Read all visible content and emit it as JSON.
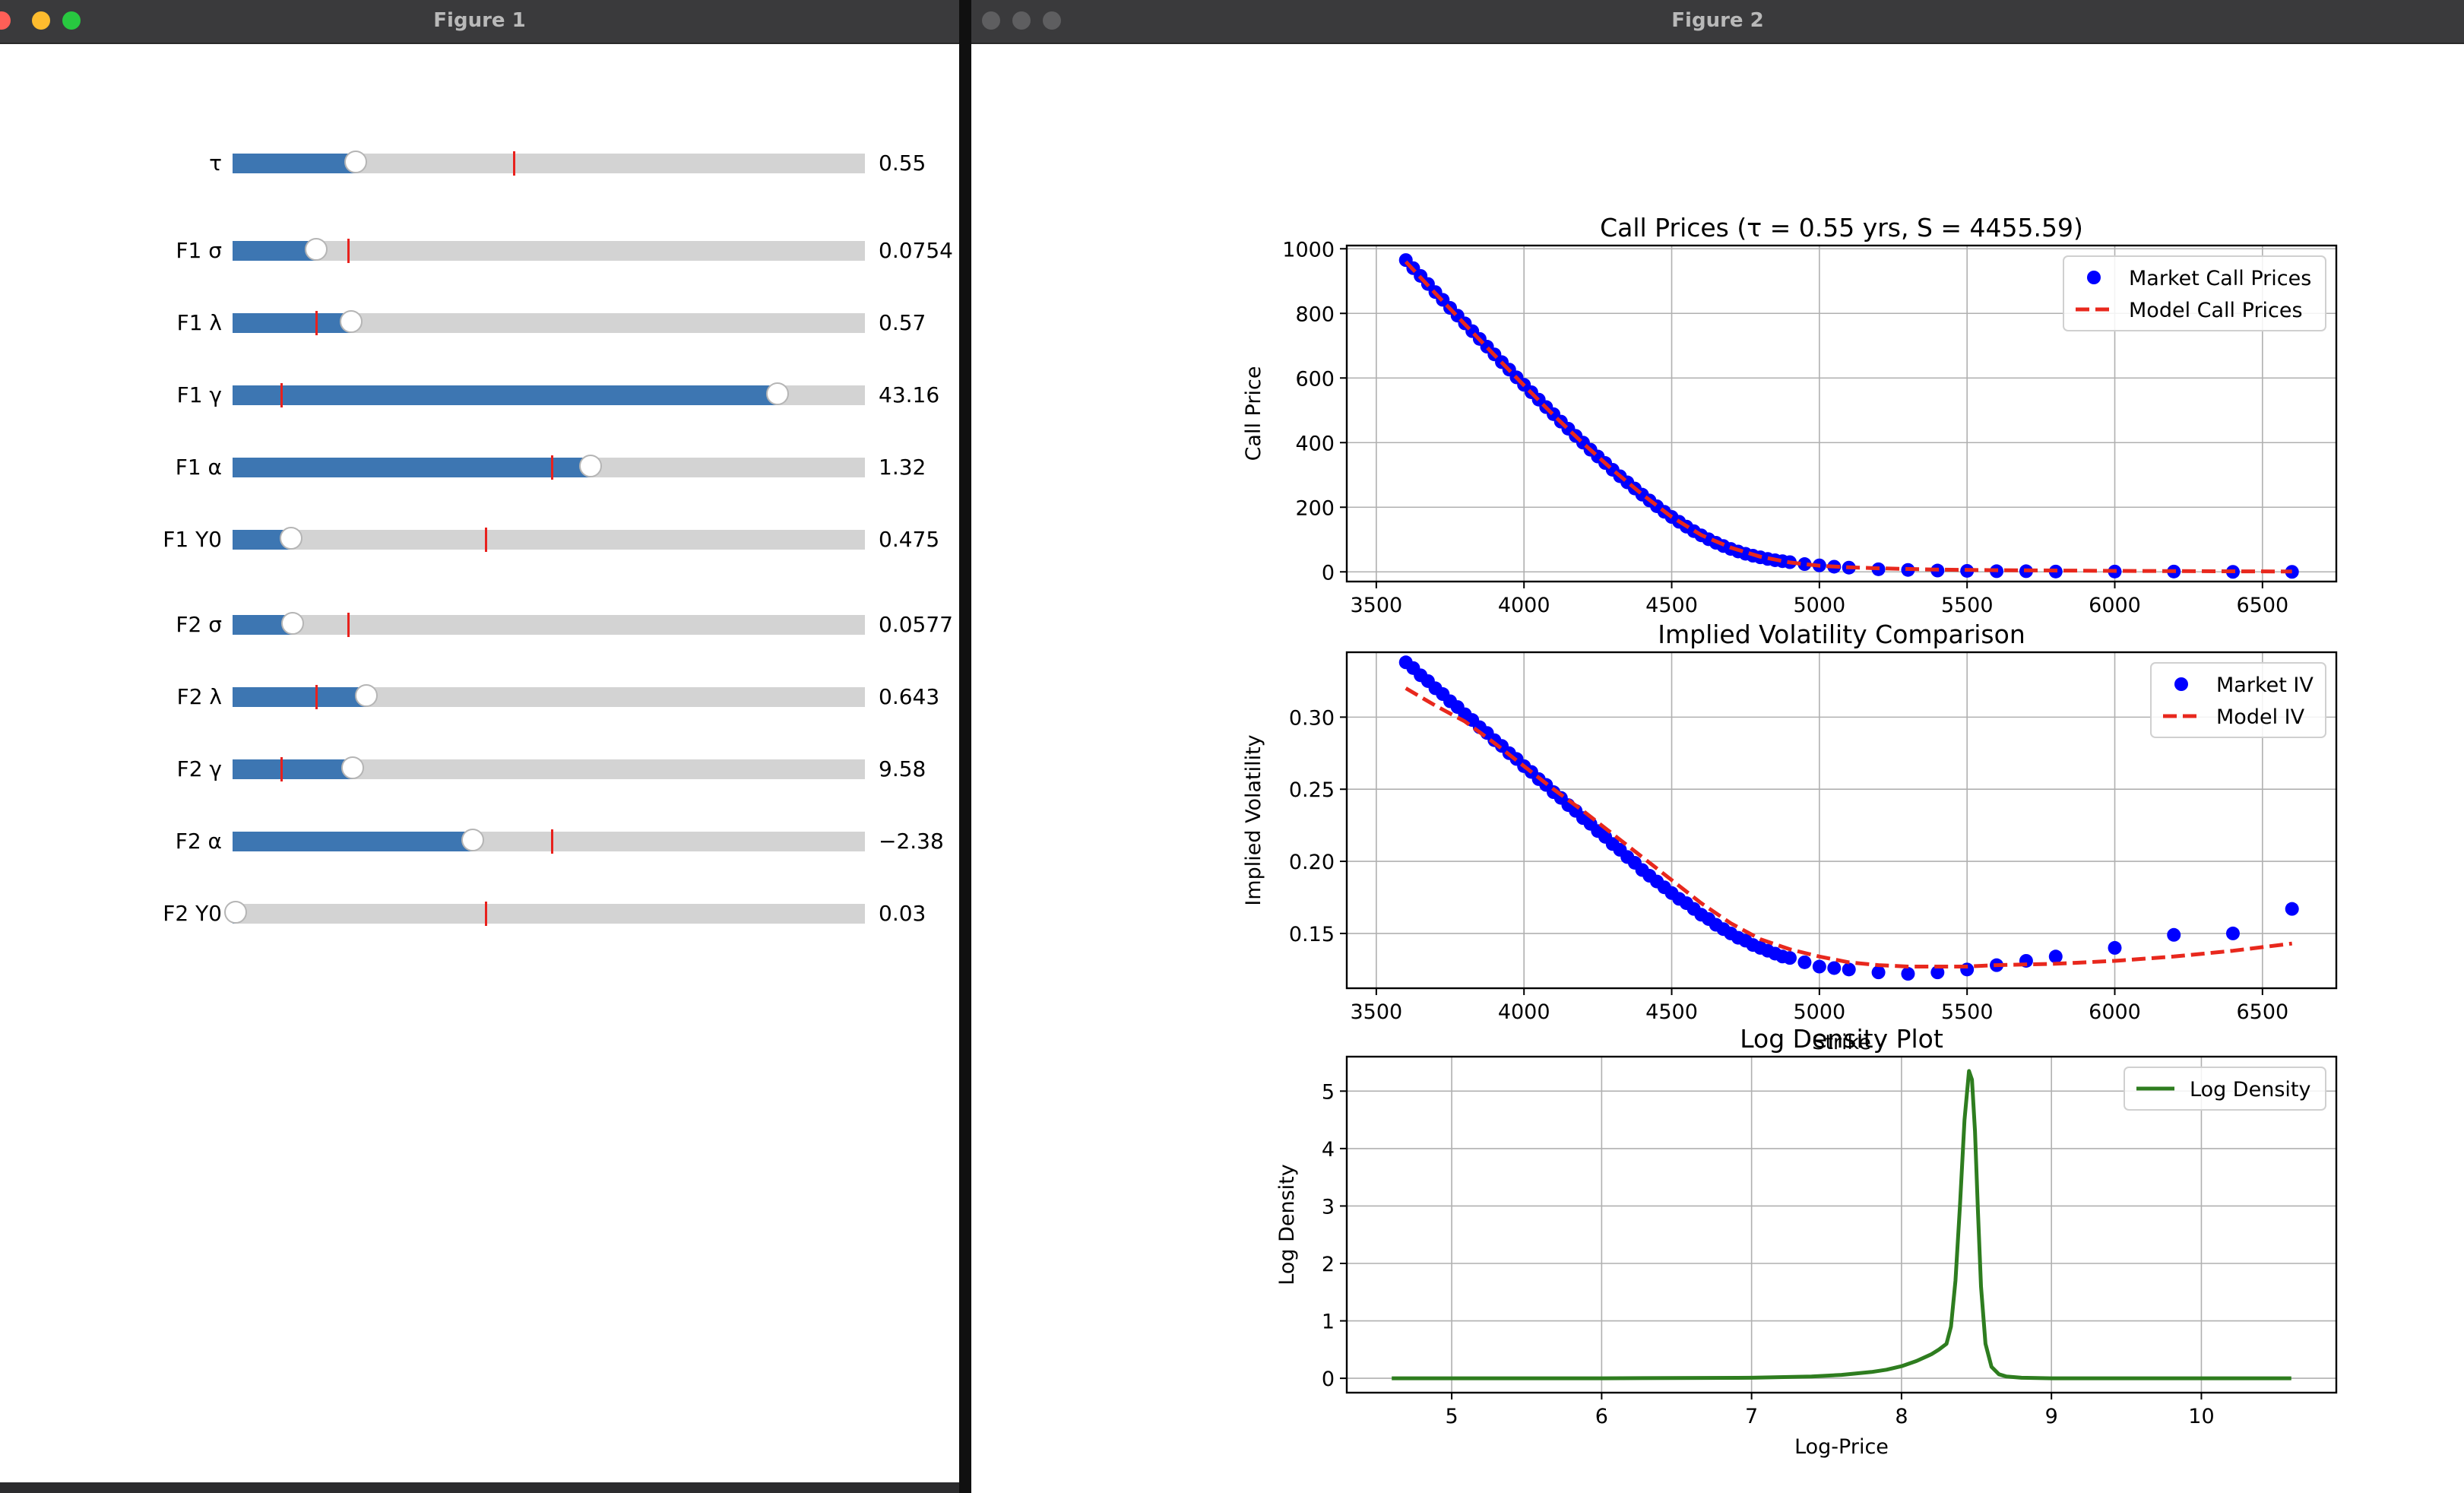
{
  "figure1": {
    "title": "Figure 1",
    "sliders": [
      {
        "label": "τ",
        "value_text": "0.55",
        "fill": 0.195,
        "init": 0.445
      },
      {
        "label": "F1 σ",
        "value_text": "0.0754",
        "fill": 0.132,
        "init": 0.183
      },
      {
        "label": "F1 λ",
        "value_text": "0.57",
        "fill": 0.187,
        "init": 0.132
      },
      {
        "label": "F1 γ",
        "value_text": "43.16",
        "fill": 0.862,
        "init": 0.077
      },
      {
        "label": "F1 α",
        "value_text": "1.32",
        "fill": 0.566,
        "init": 0.505
      },
      {
        "label": "F1 Y0",
        "value_text": "0.475",
        "fill": 0.093,
        "init": 0.4
      },
      {
        "label": "F2 σ",
        "value_text": "0.0577",
        "fill": 0.095,
        "init": 0.183
      },
      {
        "label": "F2 λ",
        "value_text": "0.643",
        "fill": 0.212,
        "init": 0.132
      },
      {
        "label": "F2 γ",
        "value_text": "9.58",
        "fill": 0.19,
        "init": 0.077
      },
      {
        "label": "F2 α",
        "value_text": "−2.38",
        "fill": 0.38,
        "init": 0.505
      },
      {
        "label": "F2 Y0",
        "value_text": "0.03",
        "fill": 0.005,
        "init": 0.4
      }
    ]
  },
  "figure2": {
    "title": "Figure 2"
  },
  "colors": {
    "market": "#0000ff",
    "model": "#e8281d",
    "density": "#2e7d1f",
    "slider_fill": "#3d76b2",
    "slider_track": "#d3d3d3",
    "slider_init": "#e8211d"
  },
  "chart_data": [
    {
      "type": "scatter",
      "title": "Call Prices (τ = 0.55 yrs, S = 4455.59)",
      "xlabel": "",
      "ylabel": "Call Price",
      "xlim": [
        3400,
        6750
      ],
      "ylim": [
        -30,
        1010
      ],
      "xticks": [
        3500,
        4000,
        4500,
        5000,
        5500,
        6000,
        6500
      ],
      "yticks": [
        0,
        200,
        400,
        600,
        800,
        1000
      ],
      "grid": true,
      "legend_position": "top-right",
      "series": [
        {
          "name": "Market Call Prices",
          "style": "markers",
          "x": [
            3600,
            3625,
            3650,
            3675,
            3700,
            3725,
            3750,
            3775,
            3800,
            3825,
            3850,
            3875,
            3900,
            3925,
            3950,
            3975,
            4000,
            4025,
            4050,
            4075,
            4100,
            4125,
            4150,
            4175,
            4200,
            4225,
            4250,
            4275,
            4300,
            4325,
            4350,
            4375,
            4400,
            4425,
            4450,
            4475,
            4500,
            4525,
            4550,
            4575,
            4600,
            4625,
            4650,
            4675,
            4700,
            4725,
            4750,
            4775,
            4800,
            4825,
            4850,
            4875,
            4900,
            4950,
            5000,
            5050,
            5100,
            5200,
            5300,
            5400,
            5500,
            5600,
            5700,
            5800,
            6000,
            6200,
            6400,
            6600
          ],
          "y": [
            965,
            940,
            916,
            891,
            866,
            842,
            817,
            793,
            769,
            745,
            721,
            697,
            673,
            649,
            626,
            602,
            579,
            556,
            533,
            510,
            488,
            465,
            443,
            421,
            400,
            378,
            357,
            337,
            316,
            296,
            277,
            258,
            239,
            221,
            203,
            186,
            170,
            155,
            140,
            126,
            113,
            101,
            90,
            80,
            71,
            63,
            56,
            50,
            45,
            40,
            36,
            33,
            30,
            24,
            20,
            16,
            13,
            8,
            6,
            4,
            3,
            2,
            2,
            1,
            1,
            1,
            0,
            0
          ]
        },
        {
          "name": "Model Call Prices",
          "style": "dashed",
          "x": [
            3600,
            3700,
            3800,
            3900,
            4000,
            4100,
            4200,
            4300,
            4400,
            4500,
            4600,
            4700,
            4800,
            4900,
            5000,
            5100,
            5200,
            5400,
            5600,
            5800,
            6000,
            6300,
            6600
          ],
          "y": [
            960,
            862,
            766,
            671,
            577,
            485,
            398,
            316,
            240,
            170,
            114,
            75,
            47,
            29,
            19,
            14,
            11,
            7,
            5,
            4,
            3,
            2,
            1
          ]
        }
      ]
    },
    {
      "type": "scatter",
      "title": "Implied Volatility Comparison",
      "xlabel": "Strike",
      "ylabel": "Implied Volatility",
      "xlim": [
        3400,
        6750
      ],
      "ylim": [
        0.112,
        0.345
      ],
      "xticks": [
        3500,
        4000,
        4500,
        5000,
        5500,
        6000,
        6500
      ],
      "yticks": [
        0.15,
        0.2,
        0.25,
        0.3
      ],
      "ytick_labels": [
        "0.15",
        "0.20",
        "0.25",
        "0.30"
      ],
      "grid": true,
      "legend_position": "top-right",
      "series": [
        {
          "name": "Market IV",
          "style": "markers",
          "x": [
            3600,
            3625,
            3650,
            3675,
            3700,
            3725,
            3750,
            3775,
            3800,
            3825,
            3850,
            3875,
            3900,
            3925,
            3950,
            3975,
            4000,
            4025,
            4050,
            4075,
            4100,
            4125,
            4150,
            4175,
            4200,
            4225,
            4250,
            4275,
            4300,
            4325,
            4350,
            4375,
            4400,
            4425,
            4450,
            4475,
            4500,
            4525,
            4550,
            4575,
            4600,
            4625,
            4650,
            4675,
            4700,
            4725,
            4750,
            4775,
            4800,
            4825,
            4850,
            4875,
            4900,
            4950,
            5000,
            5050,
            5100,
            5200,
            5300,
            5400,
            5500,
            5600,
            5700,
            5800,
            6000,
            6200,
            6400,
            6600
          ],
          "y": [
            0.338,
            0.334,
            0.329,
            0.325,
            0.32,
            0.316,
            0.311,
            0.307,
            0.302,
            0.298,
            0.293,
            0.289,
            0.284,
            0.28,
            0.275,
            0.271,
            0.266,
            0.262,
            0.257,
            0.253,
            0.248,
            0.244,
            0.239,
            0.235,
            0.23,
            0.226,
            0.221,
            0.217,
            0.212,
            0.208,
            0.203,
            0.199,
            0.194,
            0.19,
            0.186,
            0.182,
            0.178,
            0.174,
            0.171,
            0.167,
            0.163,
            0.16,
            0.156,
            0.153,
            0.15,
            0.147,
            0.145,
            0.142,
            0.14,
            0.138,
            0.136,
            0.134,
            0.133,
            0.13,
            0.127,
            0.126,
            0.125,
            0.123,
            0.122,
            0.123,
            0.125,
            0.128,
            0.131,
            0.134,
            0.14,
            0.149,
            0.15,
            0.167
          ]
        },
        {
          "name": "Model IV",
          "style": "dashed",
          "x": [
            3600,
            3700,
            3800,
            3900,
            4000,
            4100,
            4200,
            4300,
            4400,
            4500,
            4600,
            4700,
            4800,
            4900,
            5000,
            5100,
            5200,
            5300,
            5400,
            5500,
            5600,
            5800,
            6000,
            6200,
            6400,
            6600
          ],
          "y": [
            0.32,
            0.308,
            0.297,
            0.282,
            0.266,
            0.25,
            0.235,
            0.219,
            0.203,
            0.187,
            0.171,
            0.157,
            0.146,
            0.139,
            0.134,
            0.13,
            0.128,
            0.127,
            0.127,
            0.127,
            0.128,
            0.129,
            0.131,
            0.134,
            0.138,
            0.143
          ]
        }
      ]
    },
    {
      "type": "line",
      "title": "Log Density Plot",
      "xlabel": "Log-Price",
      "ylabel": "Log Density",
      "xlim": [
        4.3,
        10.9
      ],
      "ylim": [
        -0.25,
        5.6
      ],
      "xticks": [
        5,
        6,
        7,
        8,
        9,
        10
      ],
      "yticks": [
        0,
        1,
        2,
        3,
        4,
        5
      ],
      "grid": true,
      "legend_position": "top-right",
      "series": [
        {
          "name": "Log Density",
          "style": "solid",
          "x": [
            4.6,
            6.0,
            7.0,
            7.4,
            7.6,
            7.8,
            7.9,
            8.0,
            8.1,
            8.2,
            8.25,
            8.3,
            8.33,
            8.36,
            8.39,
            8.42,
            8.45,
            8.47,
            8.49,
            8.51,
            8.53,
            8.56,
            8.6,
            8.65,
            8.7,
            8.8,
            9.0,
            10.6
          ],
          "y": [
            0,
            0,
            0.01,
            0.03,
            0.06,
            0.11,
            0.15,
            0.21,
            0.3,
            0.42,
            0.5,
            0.6,
            0.9,
            1.7,
            3.0,
            4.5,
            5.35,
            5.2,
            4.3,
            2.9,
            1.6,
            0.6,
            0.2,
            0.07,
            0.03,
            0.01,
            0,
            0
          ]
        }
      ]
    }
  ]
}
